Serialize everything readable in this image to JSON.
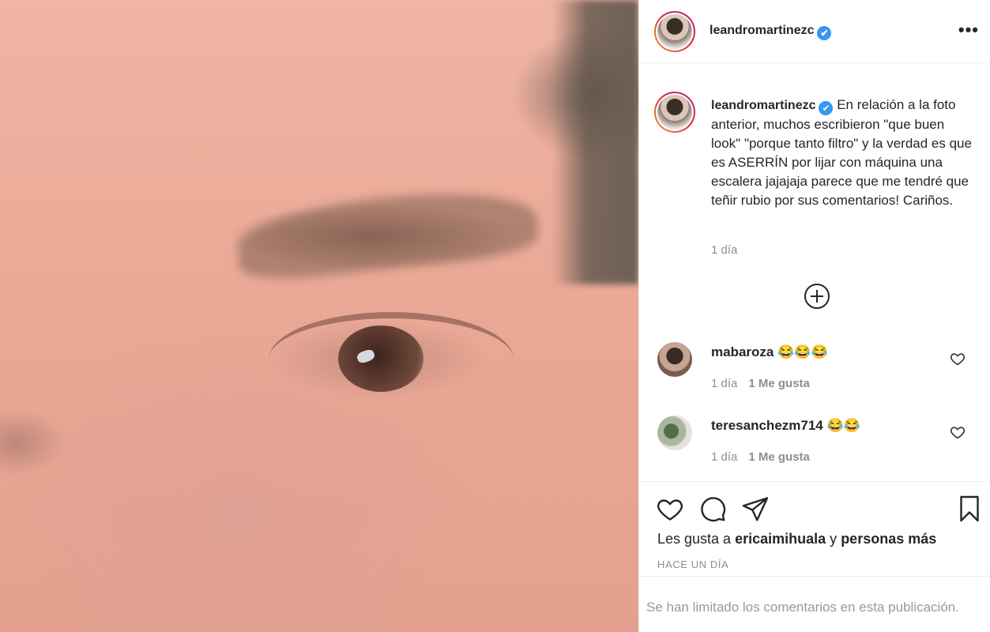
{
  "post": {
    "author": "leandromartinezc",
    "verified_glyph": "✔",
    "more_glyph": "•••",
    "caption": "En relación a la foto anterior, muchos escribieron \"que buen look\" \"porque tanto filtro\" y la verdad es que es ASERRÍN por lijar con máquina una escalera jajajaja parece que me tendré que teñir rubio por sus comentarios! Cariños.",
    "caption_time": "1 día"
  },
  "comments": [
    {
      "user": "mabaroza",
      "text": "😂😂😂",
      "time": "1 día",
      "likes": "1 Me gusta"
    },
    {
      "user": "teresanchezm714",
      "text": "😂😂",
      "time": "1 día",
      "likes": "1 Me gusta"
    }
  ],
  "actions": {
    "icons": [
      "heart-icon",
      "comment-icon",
      "share-icon",
      "bookmark-icon"
    ],
    "likes_prefix": "Les gusta a",
    "liked_by": "ericaimihuala",
    "likes_connector": "y",
    "likes_others": "personas más",
    "post_time": "HACE UN DÍA"
  },
  "footer": {
    "limited_comments": "Se han limitado los comentarios en esta publicación."
  },
  "colors": {
    "verified": "#3897f0",
    "muted": "#8e8e8e",
    "text": "#262626",
    "divider": "#efefef"
  }
}
